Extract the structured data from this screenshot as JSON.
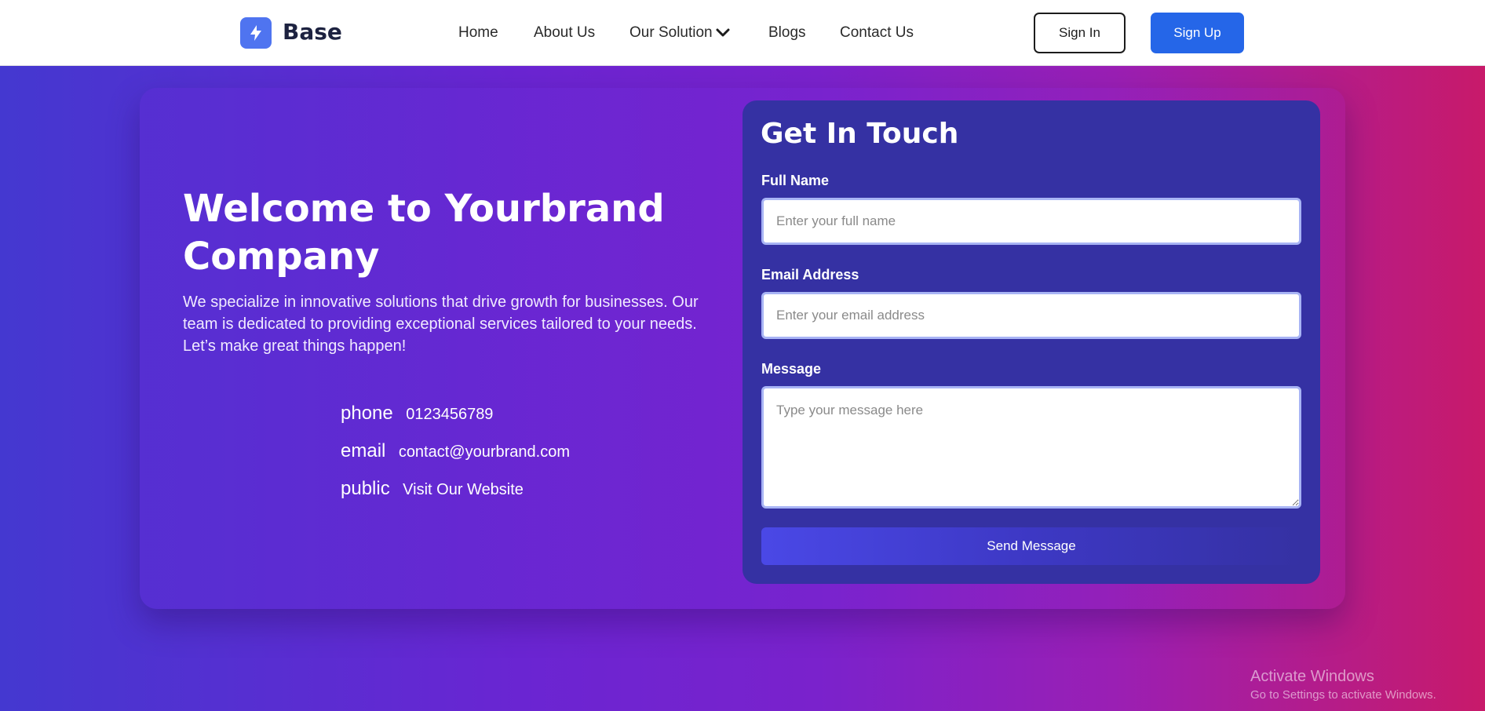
{
  "nav": {
    "brand": "Base",
    "links": [
      "Home",
      "About Us",
      "Our Solution",
      "Blogs",
      "Contact Us"
    ],
    "signin": "Sign In",
    "signup": "Sign Up"
  },
  "hero": {
    "title_line1": "Welcome to Yourbrand",
    "title_line2": "Company",
    "text": "We specialize in innovative solutions that drive growth for businesses. Our team is dedicated to providing exceptional services tailored to your needs. Let’s make great things happen!"
  },
  "contact_info": [
    {
      "label": "phone",
      "value": "0123456789"
    },
    {
      "label": "email",
      "value": "contact@yourbrand.com"
    },
    {
      "label": "public",
      "value": "Visit Our Website"
    }
  ],
  "form": {
    "title": "Get In Touch",
    "name_label": "Full Name",
    "name_placeholder": "Enter your full name",
    "email_label": "Email Address",
    "email_placeholder": "Enter your email address",
    "message_label": "Message",
    "message_placeholder": "Type your message here",
    "submit": "Send Message"
  },
  "watermark": {
    "title": "Activate Windows",
    "subtitle": "Go to Settings to activate Windows."
  },
  "icons": {
    "logo": "lightning-bolt-icon",
    "dropdown": "chevron-down-icon"
  },
  "colors": {
    "primary": "#2566e8",
    "logo": "#4f74f0",
    "form_panel": "#3531a3"
  }
}
